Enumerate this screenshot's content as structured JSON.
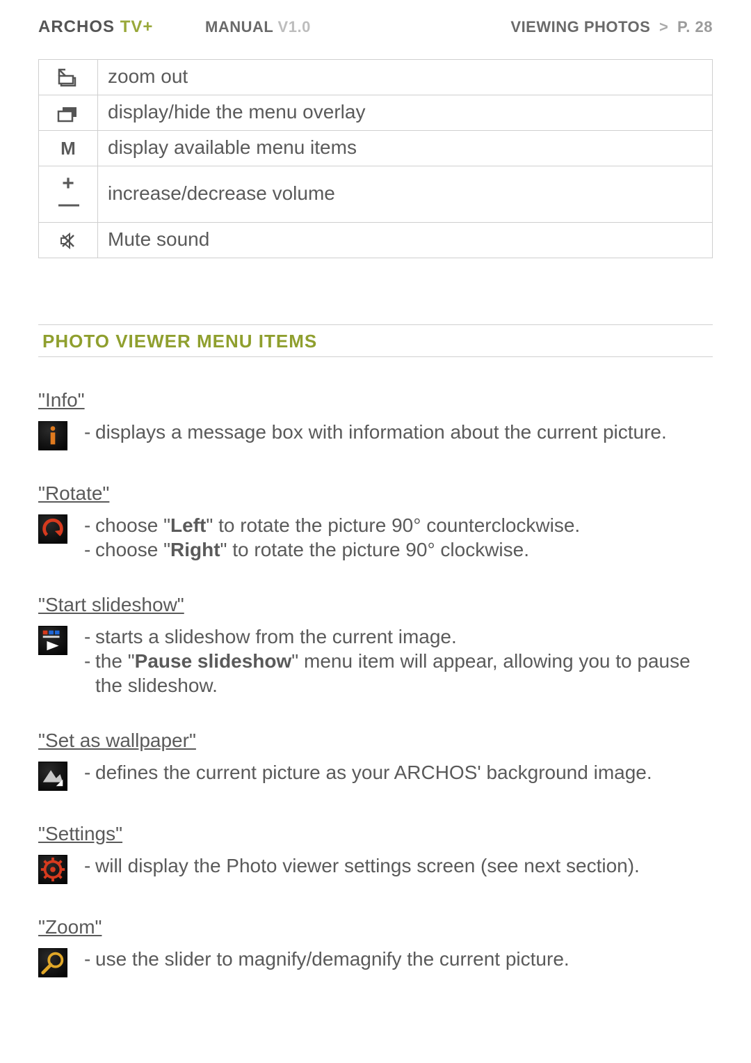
{
  "header": {
    "brand1": "ARCHOS",
    "brand2": "TV+",
    "manual": "MANUAL",
    "version": "V1.0",
    "section": "VIEWING PHOTOS",
    "gt": ">",
    "page": "P. 28"
  },
  "controls": [
    {
      "icon": "zoom-out-icon",
      "label": "zoom out"
    },
    {
      "icon": "overlay-icon",
      "label": "display/hide the menu overlay"
    },
    {
      "icon": "M",
      "label": "display available menu items"
    },
    {
      "icon": "plus-minus",
      "label": "increase/decrease volume"
    },
    {
      "icon": "mute-icon",
      "label": "Mute sound"
    }
  ],
  "section_title": "PHOTO VIEWER MENU ITEMS",
  "items": {
    "info": {
      "title": "\"Info\"",
      "b0": "displays a message box with information about the current picture."
    },
    "rotate": {
      "title": "\"Rotate\"",
      "b0a": "choose \"",
      "b0b": "Left",
      "b0c": "\" to rotate the picture 90° counterclockwise.",
      "b1a": "choose \"",
      "b1b": "Right",
      "b1c": "\" to rotate the picture 90° clockwise."
    },
    "slideshow": {
      "title": "\"Start slideshow\"",
      "b0": "starts a slideshow from the current image.",
      "b1a": "the \"",
      "b1b": "Pause slideshow",
      "b1c": "\" menu item will appear, allowing you to pause the slideshow."
    },
    "wallpaper": {
      "title": "\"Set as wallpaper\"",
      "b0": "defines the current picture as your ARCHOS' background image."
    },
    "settings": {
      "title": "\"Settings\"",
      "b0": "will display the Photo viewer settings screen (see next section)."
    },
    "zoom": {
      "title": "\"Zoom\"",
      "b0": "use the slider to magnify/demagnify the current picture."
    }
  },
  "dash": "-"
}
